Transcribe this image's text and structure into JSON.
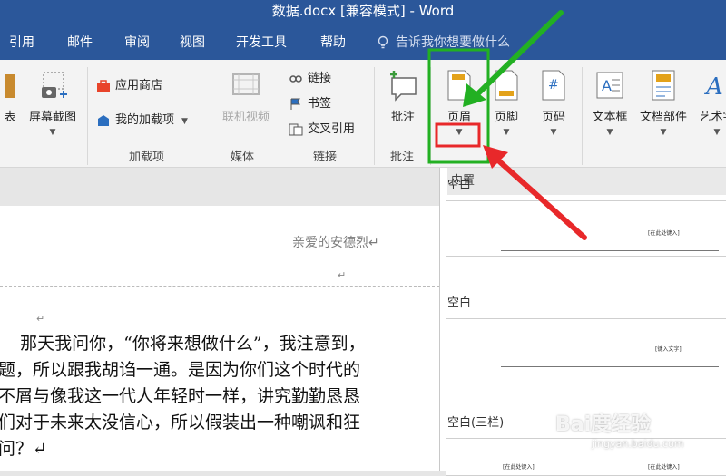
{
  "window": {
    "title": "数据.docx [兼容模式]  -  Word"
  },
  "tabs": [
    {
      "label": "引用"
    },
    {
      "label": "邮件"
    },
    {
      "label": "审阅"
    },
    {
      "label": "视图"
    },
    {
      "label": "开发工具"
    },
    {
      "label": "帮助"
    }
  ],
  "tell_me": {
    "placeholder": "告诉我你想要做什么"
  },
  "ribbon": {
    "partial_table_label": "表",
    "screenshot_label": "屏幕截图",
    "addins": {
      "store_label": "应用商店",
      "my_addins_label": "我的加载项",
      "group_label": "加载项"
    },
    "media": {
      "online_video_label": "联机视频",
      "group_label": "媒体"
    },
    "links": {
      "link_label": "链接",
      "bookmark_label": "书签",
      "cross_ref_label": "交叉引用",
      "group_label": "链接"
    },
    "comments": {
      "comment_label": "批注",
      "group_label": "批注"
    },
    "header_footer": {
      "header_label": "页眉",
      "footer_label": "页脚",
      "page_number_label": "页码"
    },
    "text": {
      "textbox_label": "文本框",
      "quickparts_label": "文档部件",
      "wordart_label": "艺术字"
    },
    "partial_group_label": "内置"
  },
  "document": {
    "header_text": "亲爱的安德烈↵",
    "header_return": "↵",
    "para_mark": "↵",
    "paragraph": "    那天我问你，“你将来想做什么”，我注意到，\n题，所以跟我胡诌一通。是因为你们这个时代的\n不屑与像我这一代人年轻时一样，讲究勤勤恳恳\n们对于未来太没信心，所以假装出一种嘲讽和狂\n问？↵"
  },
  "gallery": {
    "title": "内置",
    "sections": [
      {
        "label": "空白",
        "placeholder": "[在此处键入]"
      },
      {
        "label": "空白",
        "placeholder": "[键入文字]"
      },
      {
        "label": "空白(三栏)",
        "placeholder": "[在此处键入]"
      }
    ]
  },
  "watermark": {
    "brand": "Bai度经验",
    "url": "jingyan.baidu.com"
  },
  "colors": {
    "title_bar": "#2b579a",
    "highlight_green": "#22b022",
    "highlight_red": "#e8282a"
  }
}
